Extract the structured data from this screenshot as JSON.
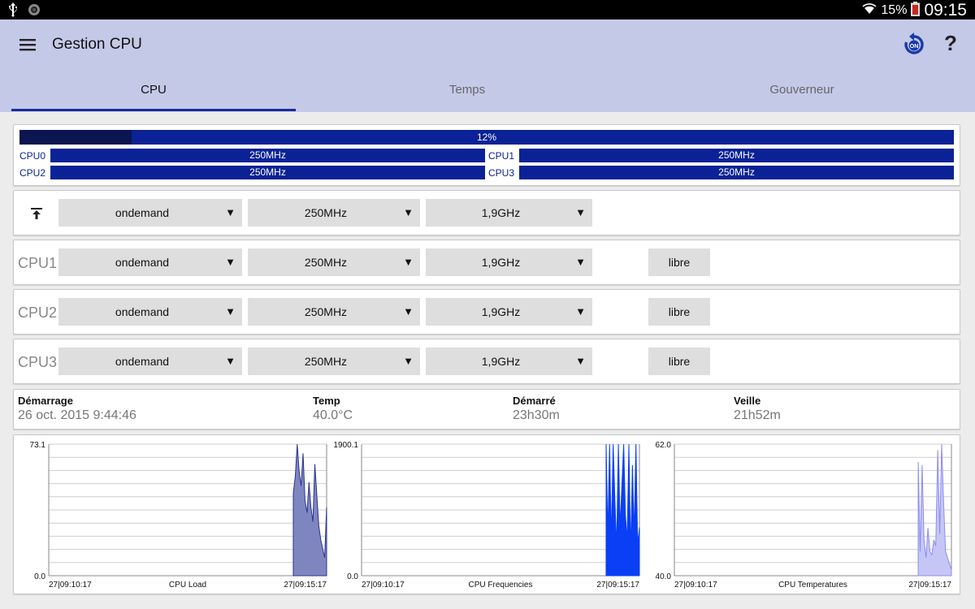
{
  "status": {
    "battery": "15%",
    "time": "09:15"
  },
  "app": {
    "title": "Gestion CPU",
    "menu_icon": "hamburger-menu-icon",
    "refresh_icon": "refresh-on-icon",
    "help_label": "?"
  },
  "tabs": [
    {
      "label": "CPU",
      "active": true
    },
    {
      "label": "Temps",
      "active": false
    },
    {
      "label": "Gouverneur",
      "active": false
    }
  ],
  "overview": {
    "total_load": 12,
    "total_label": "12%",
    "cores": [
      {
        "name": "CPU0",
        "freq": "250MHz"
      },
      {
        "name": "CPU1",
        "freq": "250MHz"
      },
      {
        "name": "CPU2",
        "freq": "250MHz"
      },
      {
        "name": "CPU3",
        "freq": "250MHz"
      }
    ]
  },
  "controls": {
    "all_icon": "align-top-icon",
    "global": {
      "governor": "ondemand",
      "min": "250MHz",
      "max": "1,9GHz"
    },
    "rows": [
      {
        "label": "CPU1",
        "governor": "ondemand",
        "min": "250MHz",
        "max": "1,9GHz",
        "button": "libre"
      },
      {
        "label": "CPU2",
        "governor": "ondemand",
        "min": "250MHz",
        "max": "1,9GHz",
        "button": "libre"
      },
      {
        "label": "CPU3",
        "governor": "ondemand",
        "min": "250MHz",
        "max": "1,9GHz",
        "button": "libre"
      }
    ]
  },
  "info": [
    {
      "label": "Démarrage",
      "value": "26 oct. 2015 9:44:46"
    },
    {
      "label": "Temp",
      "value": "40.0°C"
    },
    {
      "label": "Démarré",
      "value": "23h30m"
    },
    {
      "label": "Veille",
      "value": "21h52m"
    }
  ],
  "colors": {
    "appbar": "#c5c9e8",
    "accent": "#0a2296",
    "load_fill": "#0b1650",
    "chart_load_line": "#2a3490",
    "chart_load_area": "#7f86bf",
    "chart_freq": "#0a3ff5",
    "chart_temp_line": "#8c8cf0",
    "chart_temp_area": "#c6c6f6"
  },
  "chart_data": [
    {
      "type": "area",
      "title": "CPU Load",
      "x_start": "27|09:10:17",
      "x_end": "27|09:15:17",
      "ylim": [
        0.0,
        73.1
      ],
      "y_max_label": "73.1",
      "y_min_label": "0.0",
      "grid": true,
      "values": [
        46,
        55,
        73.1,
        58,
        50,
        68,
        42,
        35,
        52,
        38,
        30,
        62,
        45,
        28,
        20,
        15,
        10,
        38
      ]
    },
    {
      "type": "area",
      "title": "CPU Frequencies",
      "x_start": "27|09:10:17",
      "x_end": "27|09:15:17",
      "ylim": [
        0.0,
        1900.1
      ],
      "y_max_label": "1900.1",
      "y_min_label": "0.0",
      "grid": true,
      "values": [
        1900.1,
        600,
        1900.1,
        500,
        1900.1,
        1100,
        400,
        1900.1,
        700,
        1300,
        1900.1,
        900,
        500,
        1900.1,
        350,
        1600,
        600,
        1900.1,
        450,
        700
      ]
    },
    {
      "type": "area",
      "title": "CPU Temperatures",
      "x_start": "27|09:10:17",
      "x_end": "27|09:15:17",
      "ylim": [
        40.0,
        62.0
      ],
      "y_max_label": "62.0",
      "y_min_label": "40.0",
      "grid": true,
      "values": [
        59,
        44,
        58.5,
        46,
        43,
        48,
        44,
        43.5,
        46,
        45,
        61,
        47,
        62,
        52,
        44,
        43,
        42,
        41
      ]
    }
  ]
}
